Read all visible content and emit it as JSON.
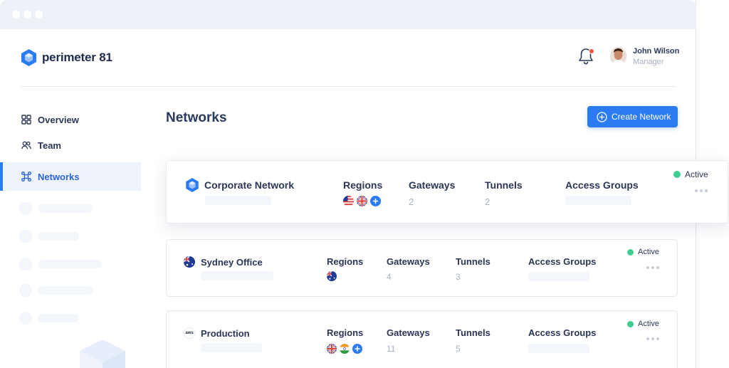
{
  "app": {
    "brand": "perimeter 81",
    "brand_color": "#2b7bf3"
  },
  "user": {
    "name": "John Wilson",
    "role": "Manager"
  },
  "sidebar": {
    "items": [
      {
        "label": "Overview",
        "icon": "grid-icon"
      },
      {
        "label": "Team",
        "icon": "team-icon"
      },
      {
        "label": "Networks",
        "icon": "network-icon",
        "active": true
      }
    ]
  },
  "page": {
    "title": "Networks",
    "create_button_label": "Create Network"
  },
  "columns": {
    "regions": "Regions",
    "gateways": "Gateways",
    "tunnels": "Tunnels",
    "access_groups": "Access Groups"
  },
  "networks": [
    {
      "name": "Corporate Network",
      "icon": "perimeter-logo-icon",
      "regions": [
        "us-flag-icon",
        "uk-flag-icon",
        "plus-icon"
      ],
      "gateways": "2",
      "tunnels": "2",
      "status": "Active"
    },
    {
      "name": "Sydney Office",
      "icon": "australia-flag-icon",
      "regions": [
        "australia-flag-icon"
      ],
      "gateways": "4",
      "tunnels": "3",
      "status": "Active"
    },
    {
      "name": "Production",
      "icon": "aws-icon",
      "aws_label": "aws",
      "regions": [
        "uk-flag-icon",
        "india-flag-icon",
        "plus-icon"
      ],
      "gateways": "11",
      "tunnels": "5",
      "status": "Active"
    }
  ],
  "colors": {
    "active_status": "#3ecf8e",
    "accent": "#2b7bf3",
    "notification_badge": "#f0533f"
  }
}
